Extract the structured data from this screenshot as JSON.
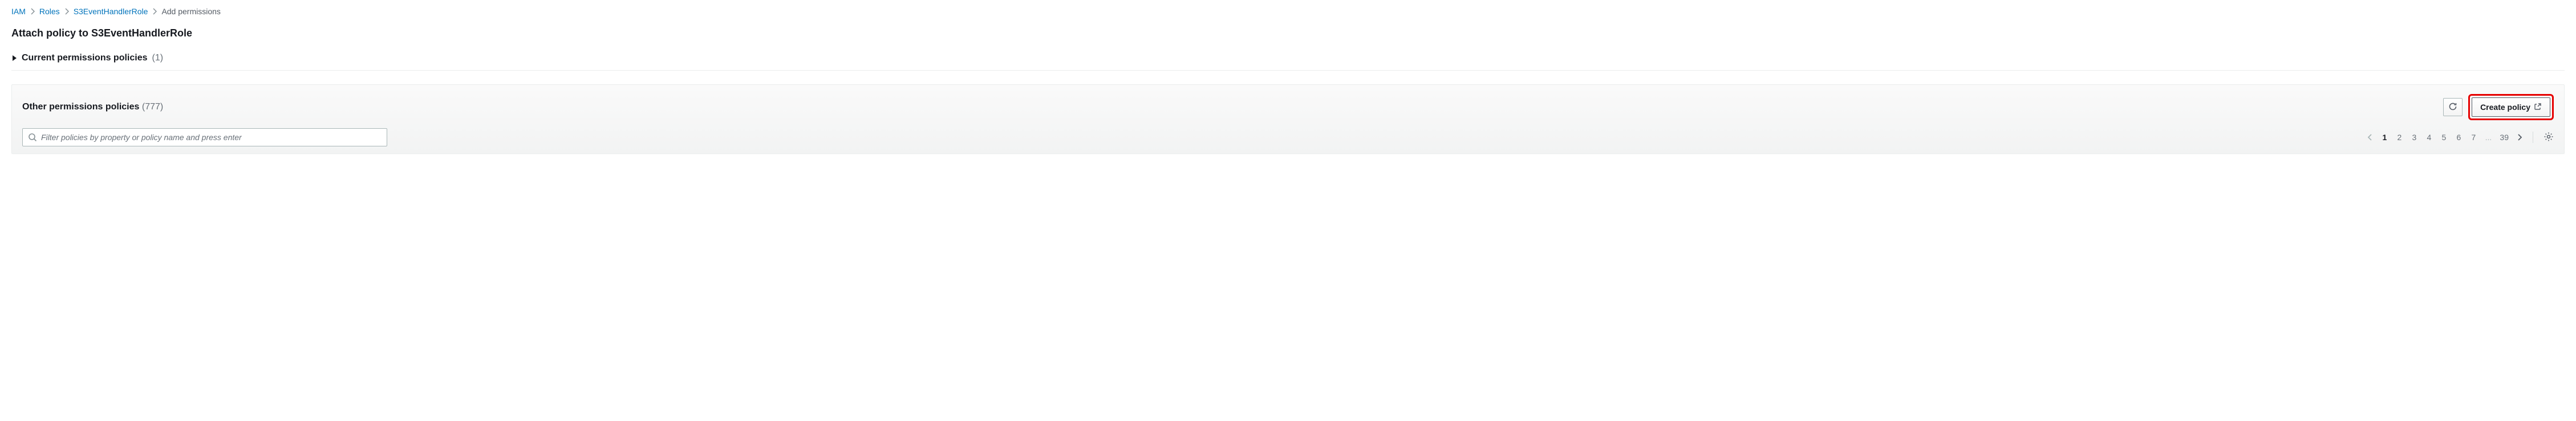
{
  "breadcrumb": {
    "items": [
      {
        "label": "IAM"
      },
      {
        "label": "Roles"
      },
      {
        "label": "S3EventHandlerRole"
      }
    ],
    "current": "Add permissions"
  },
  "page_title": "Attach policy to S3EventHandlerRole",
  "current_policies": {
    "label": "Current permissions policies",
    "count": "(1)"
  },
  "other_policies": {
    "label": "Other permissions policies",
    "count": "(777)",
    "create_button": "Create policy",
    "filter_placeholder": "Filter policies by property or policy name and press enter",
    "pagination": {
      "pages": [
        "1",
        "2",
        "3",
        "4",
        "5",
        "6",
        "7"
      ],
      "ellipsis": "...",
      "last": "39",
      "current": "1"
    }
  }
}
